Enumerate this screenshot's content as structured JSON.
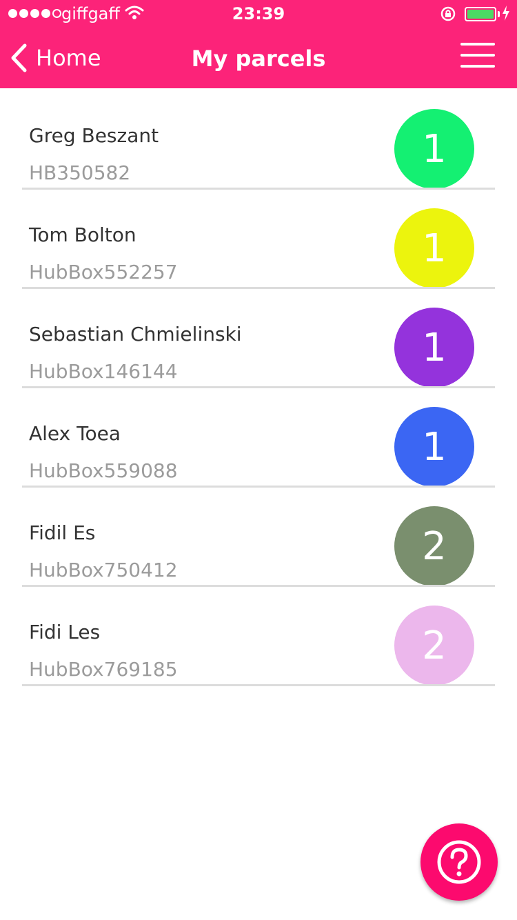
{
  "status_bar": {
    "carrier": "giffgaff",
    "time": "23:39",
    "battery_color": "#4cd964"
  },
  "header": {
    "back_label": "Home",
    "title": "My parcels",
    "bar_color": "#fc2379"
  },
  "parcels": [
    {
      "name": "Greg Beszant",
      "id": "HB350582",
      "count": "1",
      "color": "#14f072"
    },
    {
      "name": "Tom Bolton",
      "id": "HubBox552257",
      "count": "1",
      "color": "#ecf40d"
    },
    {
      "name": "Sebastian Chmielinski",
      "id": "HubBox146144",
      "count": "1",
      "color": "#9433dc"
    },
    {
      "name": "Alex Toea",
      "id": "HubBox559088",
      "count": "1",
      "color": "#3b66f3"
    },
    {
      "name": "Fidil Es",
      "id": "HubBox750412",
      "count": "2",
      "color": "#7a8f6e"
    },
    {
      "name": "Fidi Les",
      "id": "HubBox769185",
      "count": "2",
      "color": "#ecb7ec"
    }
  ],
  "help_button": {
    "icon": "question-circle-icon",
    "color": "#fc0a6e"
  }
}
